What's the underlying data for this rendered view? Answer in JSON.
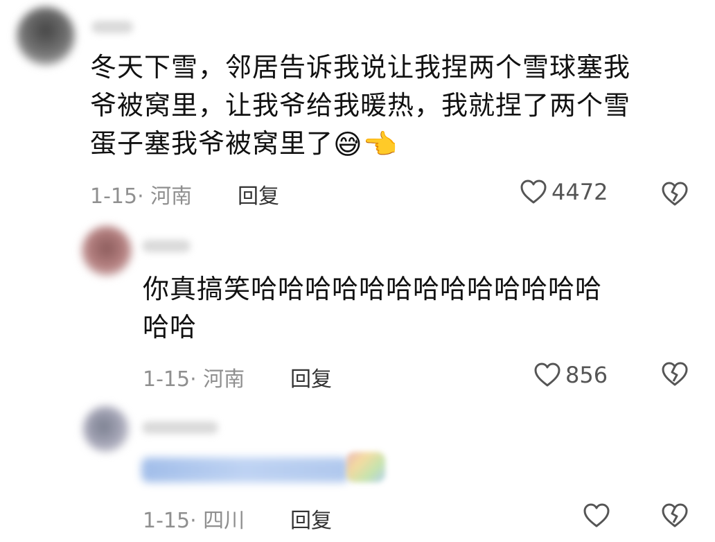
{
  "comments": [
    {
      "lines": [
        "冬天下雪，邻居告诉我说让我捏两个雪球塞我",
        "爷被窝里，让我爷给我暖热，我就捏了两个雪",
        "蛋子塞我爷被窝里了"
      ],
      "emojis": [
        "😅",
        "👈"
      ],
      "date_location": "1-15· 河南",
      "reply_label": "回复",
      "likes": "4472"
    },
    {
      "lines": [
        "你真搞笑哈哈哈哈哈哈哈哈哈哈哈哈哈",
        "哈哈"
      ],
      "date_location": "1-15· 河南",
      "reply_label": "回复",
      "likes": "856"
    },
    {
      "date_location": "1-15· 四川",
      "reply_label": "回复",
      "likes": ""
    }
  ],
  "colors": {
    "heart_stroke": "#555555",
    "meta_text": "#8f8f8f"
  },
  "icons": {
    "like": "heart-outline-icon",
    "dislike": "broken-heart-icon"
  }
}
